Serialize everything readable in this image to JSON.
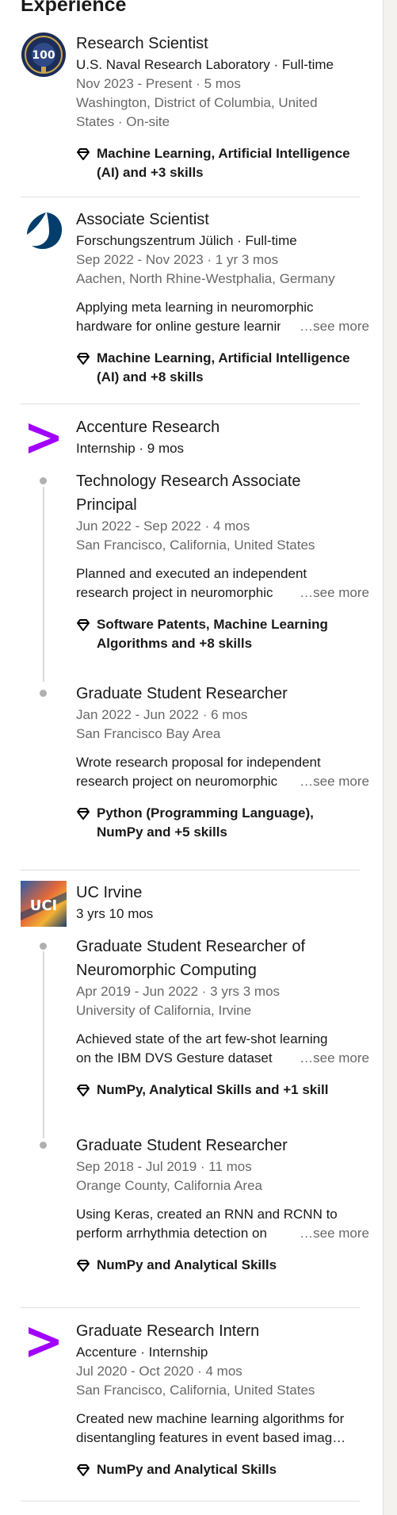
{
  "section": {
    "title": "Experience"
  },
  "nrl": {
    "logo_text": "100",
    "title": "Research Scientist",
    "company": "U.S. Naval Research Laboratory · Full-time",
    "dates": "Nov 2023 - Present · 5 mos",
    "location_1": "Washington, District of Columbia, United",
    "location_2": "States · On-site",
    "skills_1": "Machine Learning, Artificial Intelligence",
    "skills_2": "(AI) and +3 skills"
  },
  "fzj": {
    "title": "Associate Scientist",
    "company": "Forschungszentrum Jülich · Full-time",
    "dates": "Sep 2022 - Nov 2023 · 1 yr 3 mos",
    "location": "Aachen, North Rhine-Westphalia, Germany",
    "desc_1": "Applying meta learning in neuromorphic",
    "desc_2": "hardware for online gesture learning",
    "see_more": "…see more",
    "skills_1": "Machine Learning, Artificial Intelligence",
    "skills_2": "(AI) and +8 skills"
  },
  "accenture": {
    "company": "Accenture Research",
    "summary": "Internship · 9 mos",
    "roles": [
      {
        "title_1": "Technology Research Associate",
        "title_2": "Principal",
        "dates": "Jun 2022 - Sep 2022 · 4 mos",
        "location": "San Francisco, California, United States",
        "desc_1": "Planned and executed an independent",
        "desc_2": "research project in neuromorphic",
        "see_more": "…see more",
        "skills_1": "Software Patents, Machine Learning",
        "skills_2": "Algorithms and +8 skills"
      },
      {
        "title": "Graduate Student Researcher",
        "dates": "Jan 2022 - Jun 2022 · 6 mos",
        "location": "San Francisco Bay Area",
        "desc_1": "Wrote research proposal for independent",
        "desc_2": "research project on neuromorphic",
        "see_more": "…see more",
        "skills_1": "Python (Programming Language),",
        "skills_2": "NumPy and +5 skills"
      }
    ]
  },
  "uci": {
    "logo_text": "UCI",
    "company": "UC Irvine",
    "summary": "3 yrs 10 mos",
    "roles": [
      {
        "title_1": "Graduate Student Researcher of",
        "title_2": "Neuromorphic Computing",
        "dates": "Apr 2019 - Jun 2022 · 3 yrs 3 mos",
        "location": "University of California, Irvine",
        "desc_1": "Achieved state of the art few-shot learning",
        "desc_2": "on the IBM DVS Gesture dataset",
        "see_more": "…see more",
        "skills": "NumPy, Analytical Skills and +1 skill"
      },
      {
        "title": "Graduate Student Researcher",
        "dates": "Sep 2018 - Jul 2019 · 11 mos",
        "location": "Orange County, California Area",
        "desc_1": "Using Keras, created an RNN and RCNN to",
        "desc_2": "perform arrhythmia detection on",
        "see_more": "…see more",
        "skills": "NumPy and Analytical Skills"
      }
    ]
  },
  "intern": {
    "title": "Graduate Research Intern",
    "company": "Accenture · Internship",
    "dates": "Jul 2020 - Oct 2020 · 4 mos",
    "location": "San Francisco, California, United States",
    "desc_1": "Created new machine learning algorithms for",
    "desc_2": "disentangling features in event based imag…",
    "skills": "NumPy and Analytical Skills"
  },
  "colors": {
    "accenture_purple": "#a100ff",
    "fzj_blue": "#023d6b",
    "uci_blue": "#1b3d6d"
  }
}
